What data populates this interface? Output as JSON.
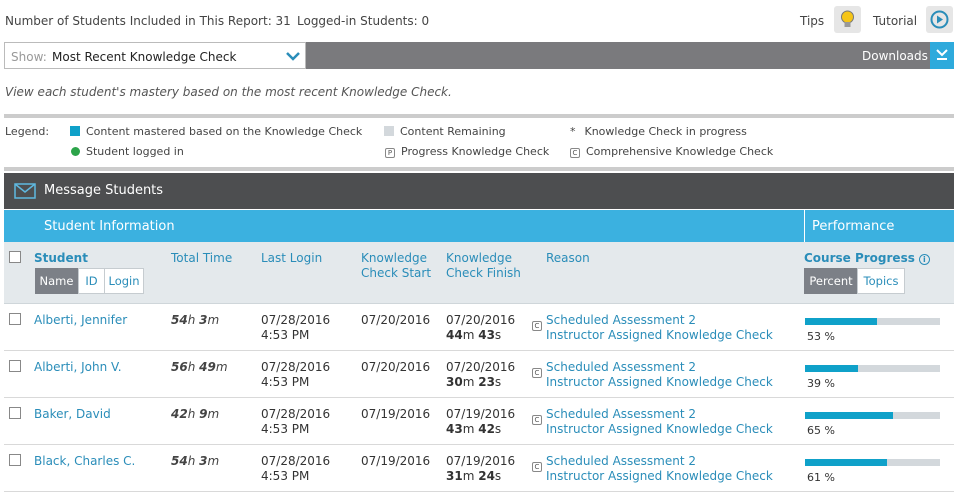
{
  "topbar": {
    "students_included": "Number of Students Included in This Report: 31",
    "logged_in": "Logged-in Students: 0",
    "tips_label": "Tips",
    "tutorial_label": "Tutorial"
  },
  "show": {
    "label": "Show:",
    "value": "Most Recent Knowledge Check"
  },
  "downloads_label": "Downloads",
  "intro_text": "View each student's mastery based on the most recent Knowledge Check.",
  "legend": {
    "title": "Legend:",
    "mastered": "Content mastered based on the Knowledge Check",
    "remaining": "Content Remaining",
    "in_progress": "Knowledge Check in progress",
    "in_progress_marker": "*",
    "logged_in": "Student logged in",
    "progress_kc": "Progress Knowledge Check",
    "progress_marker": "P",
    "comprehensive_kc": "Comprehensive Knowledge Check",
    "comprehensive_marker": "C"
  },
  "colors": {
    "mastered": "#0fa1c9",
    "remaining": "#d3d8dc",
    "logged_in": "#2ca44a",
    "accent": "#3bb1e0",
    "dark_bar": "#4d4e50"
  },
  "message_students": "Message Students",
  "sections": {
    "student_info": "Student Information",
    "performance": "Performance"
  },
  "columns": {
    "student": "Student",
    "sort_name": "Name",
    "sort_id": "ID",
    "sort_login": "Login",
    "total_time": "Total Time",
    "last_login": "Last Login",
    "kc_start_1": "Knowledge",
    "kc_start_2": "Check Start",
    "kc_finish_1": "Knowledge",
    "kc_finish_2": "Check Finish",
    "reason": "Reason",
    "course_progress": "Course Progress",
    "view_percent": "Percent",
    "view_topics": "Topics"
  },
  "students": [
    {
      "name": "Alberti, Jennifer",
      "tt_h": "54",
      "tt_m": "3",
      "login_date": "07/28/2016",
      "login_time": "4:53 PM",
      "kc_start": "07/20/2016",
      "kc_finish": "07/20/2016",
      "dur_m": "44",
      "dur_s": "43",
      "reason_1": "Scheduled Assessment 2",
      "reason_2": "Instructor Assigned Knowledge Check",
      "badge": "C",
      "progress": 53,
      "progress_label": "53 %"
    },
    {
      "name": "Alberti, John V.",
      "tt_h": "56",
      "tt_m": "49",
      "login_date": "07/28/2016",
      "login_time": "4:53 PM",
      "kc_start": "07/20/2016",
      "kc_finish": "07/20/2016",
      "dur_m": "30",
      "dur_s": "23",
      "reason_1": "Scheduled Assessment 2",
      "reason_2": "Instructor Assigned Knowledge Check",
      "badge": "C",
      "progress": 39,
      "progress_label": "39 %"
    },
    {
      "name": "Baker, David",
      "tt_h": "42",
      "tt_m": "9",
      "login_date": "07/28/2016",
      "login_time": "4:53 PM",
      "kc_start": "07/19/2016",
      "kc_finish": "07/19/2016",
      "dur_m": "43",
      "dur_s": "42",
      "reason_1": "Scheduled Assessment 2",
      "reason_2": "Instructor Assigned Knowledge Check",
      "badge": "C",
      "progress": 65,
      "progress_label": "65 %"
    },
    {
      "name": "Black, Charles C.",
      "tt_h": "54",
      "tt_m": "3",
      "login_date": "07/28/2016",
      "login_time": "4:53 PM",
      "kc_start": "07/19/2016",
      "kc_finish": "07/19/2016",
      "dur_m": "31",
      "dur_s": "24",
      "reason_1": "Scheduled Assessment 2",
      "reason_2": "Instructor Assigned Knowledge Check",
      "badge": "C",
      "progress": 61,
      "progress_label": "61 %"
    }
  ]
}
